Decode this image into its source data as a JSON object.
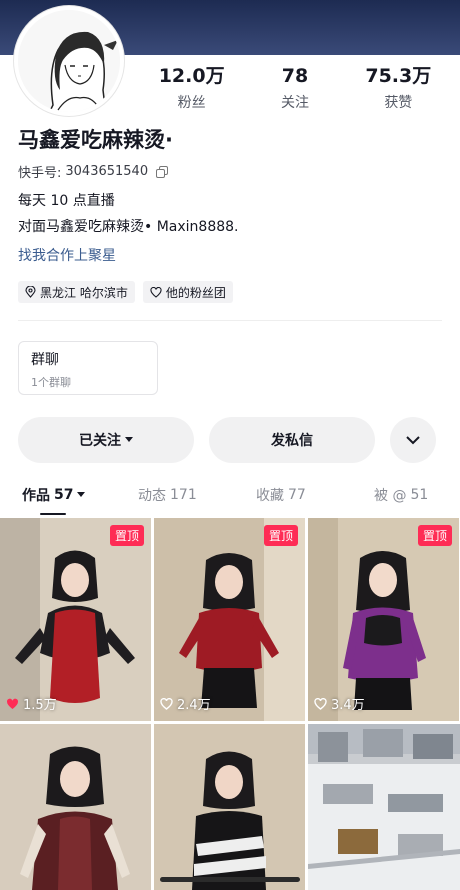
{
  "profile": {
    "name": "马鑫爱吃麻辣烫·",
    "id_label": "快手号:",
    "id_value": "3043651540",
    "bio_line1": "每天 10 点直播",
    "bio_line2": "对面马鑫爱吃麻辣烫• Maxin8888.",
    "cooperation_link": "找我合作上聚星"
  },
  "stats": [
    {
      "value": "12.0万",
      "label": "粉丝"
    },
    {
      "value": "78",
      "label": "关注"
    },
    {
      "value": "75.3万",
      "label": "获赞"
    }
  ],
  "tags": [
    {
      "text": "黑龙江 哈尔滨市",
      "icon": "location-icon"
    },
    {
      "text": "他的粉丝团",
      "icon": "heart-outline-icon"
    }
  ],
  "group": {
    "title": "群聊",
    "subtitle": "1个群聊"
  },
  "buttons": {
    "follow": "已关注",
    "message": "发私信",
    "more_icon": "chevron-down-icon"
  },
  "tabs": [
    {
      "label": "作品",
      "count": "57",
      "active": true
    },
    {
      "label": "动态",
      "count": "171",
      "active": false
    },
    {
      "label": "收藏",
      "count": "77",
      "active": false
    },
    {
      "label": "被 @",
      "count": "51",
      "active": false
    }
  ],
  "videos": [
    {
      "pinned": "置顶",
      "likes": "1.5万",
      "liked": true
    },
    {
      "pinned": "置顶",
      "likes": "2.4万",
      "liked": false
    },
    {
      "pinned": "置顶",
      "likes": "3.4万",
      "liked": false
    },
    {
      "pinned": "",
      "likes": "",
      "liked": false
    },
    {
      "pinned": "",
      "likes": "",
      "liked": false
    },
    {
      "pinned": "",
      "likes": "",
      "liked": false
    }
  ],
  "colors": {
    "accent": "#fe2c55",
    "link": "#3b5c8f",
    "text": "#161823"
  }
}
